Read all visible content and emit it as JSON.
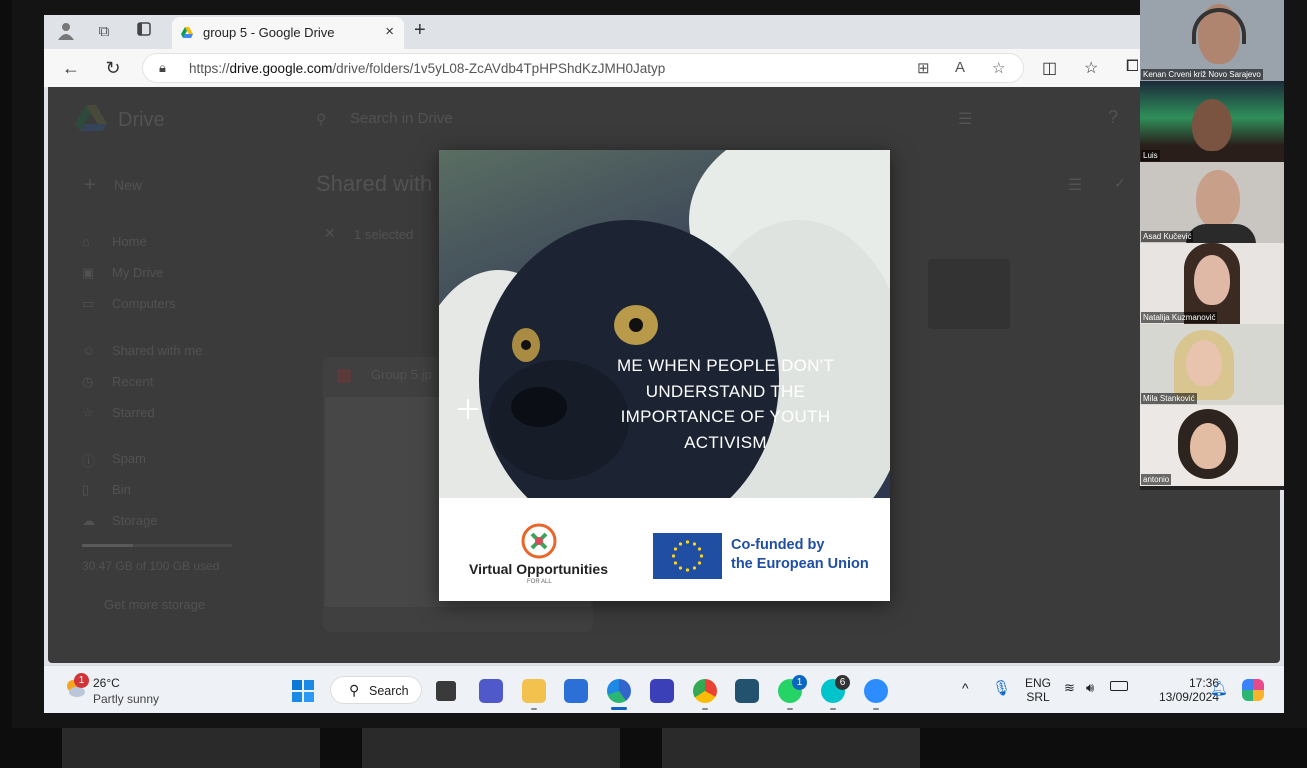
{
  "browser": {
    "tab_title": "group 5 - Google Drive",
    "tab_close": "×",
    "new_tab": "+",
    "url_prefix": "https://",
    "url_host": "drive.google.com",
    "url_path": "/drive/folders/1v5yL08-ZcAVdb4TpHPShdKzJMH0Jatyp"
  },
  "drive": {
    "logo_text": "Drive",
    "search_placeholder": "Search in Drive",
    "new_label": "New",
    "page_title": "Shared with",
    "selection": "1 selected",
    "nav": [
      "Home",
      "My Drive",
      "Computers",
      "Shared with me",
      "Recent",
      "Starred",
      "Spam",
      "Bin",
      "Storage"
    ],
    "storage_used": "30.47 GB of 100 GB used",
    "get_storage": "Get more storage",
    "file_name": "Group 5.jp"
  },
  "preview": {
    "caption_lines": [
      "ME WHEN PEOPLE DON'T",
      "UNDERSTAND THE",
      "IMPORTANCE OF YOUTH",
      "ACTIVISM"
    ],
    "vo_title": "Virtual Opportunities",
    "vo_sub": "FOR ALL",
    "eu_line1": "Co-funded by",
    "eu_line2": "the European Union"
  },
  "taskbar": {
    "weather_temp": "26°C",
    "weather_desc": "Partly sunny",
    "weather_badge": "1",
    "search_label": "Search",
    "whatsapp_badge": "1",
    "canva_badge": "6",
    "lang_line1": "ENG",
    "lang_line2": "SRL",
    "time": "17:36",
    "date": "13/09/2024"
  },
  "participants": [
    {
      "name": "Kenan Crveni križ Novo Sarajevo"
    },
    {
      "name": "Luis"
    },
    {
      "name": "Asad Kučević"
    },
    {
      "name": "Natalija Kuzmanović"
    },
    {
      "name": "Mila Stanković"
    },
    {
      "name": "antonio"
    }
  ],
  "colors": {
    "eu_blue": "#1f4ea3",
    "taskbar_bg": "#eef1f6",
    "drive_overlay": "#3b3b3b"
  }
}
